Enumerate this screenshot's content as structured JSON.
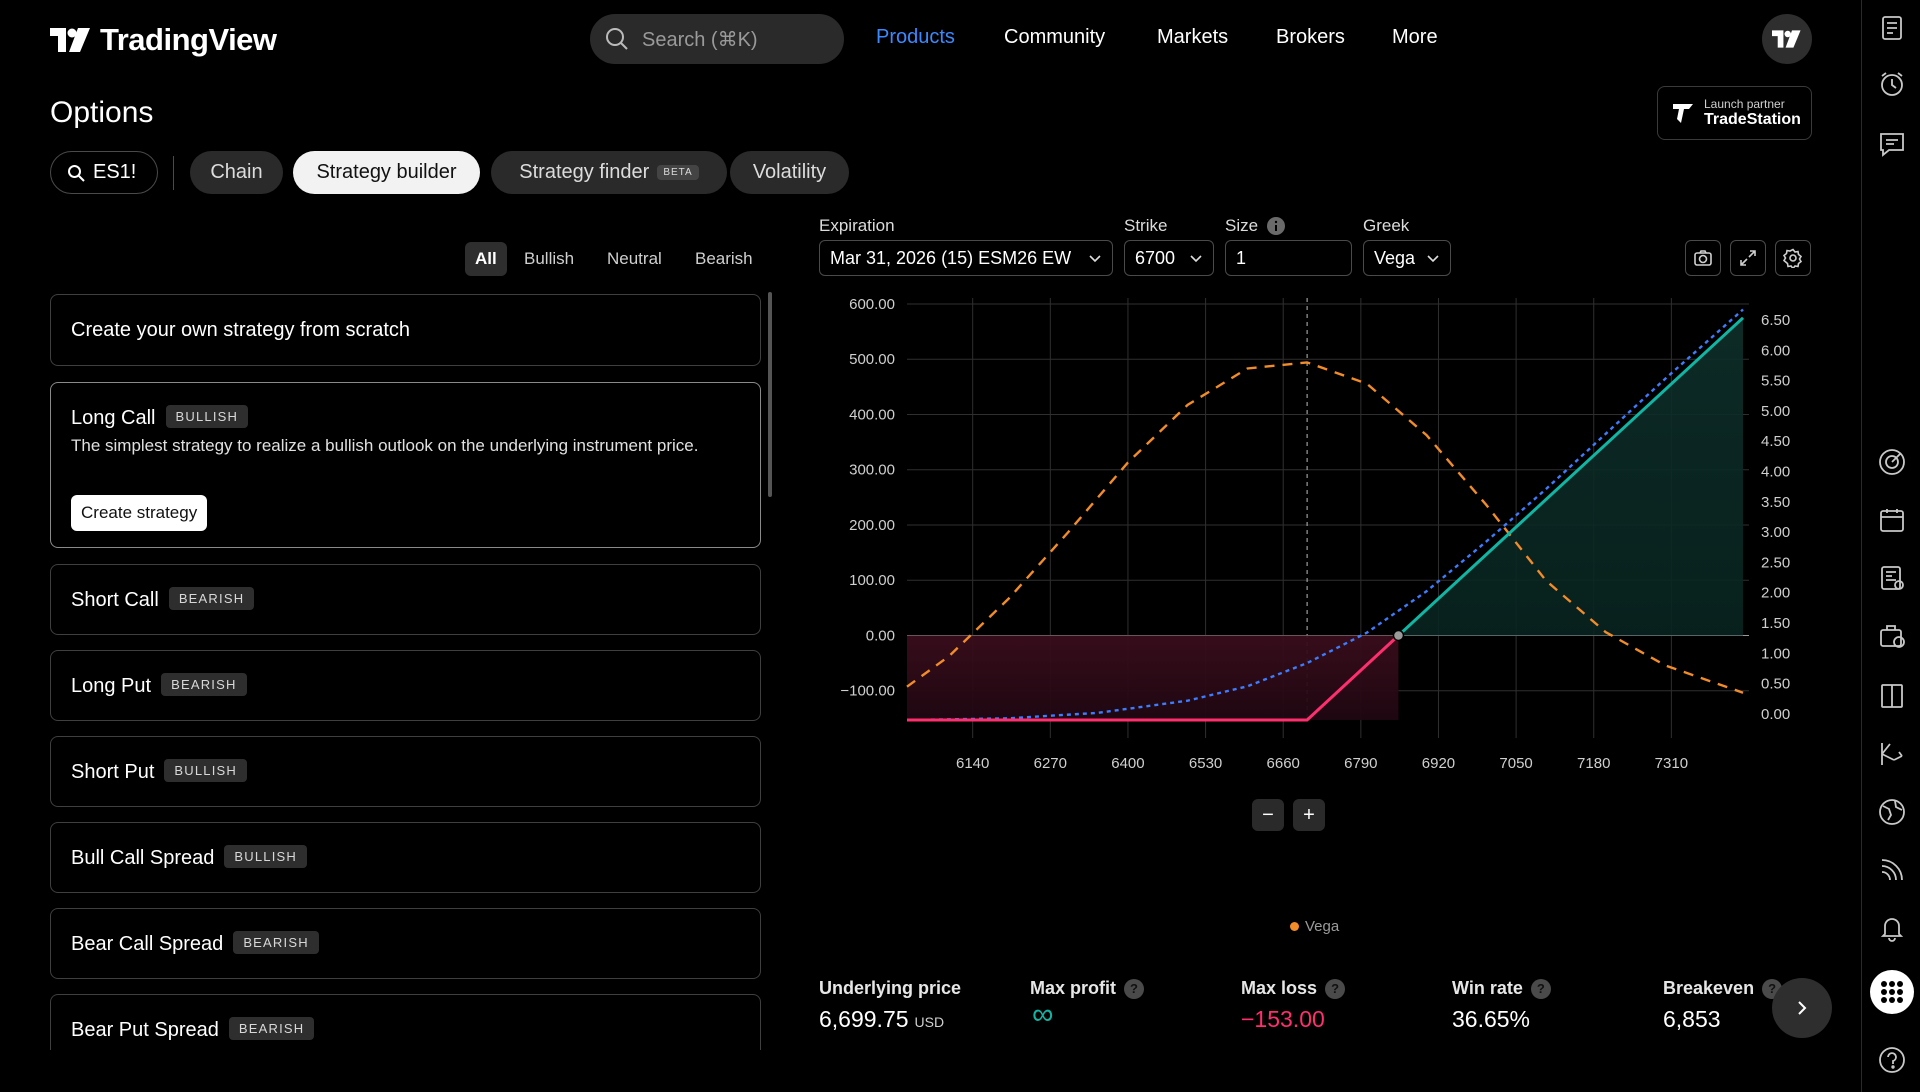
{
  "header": {
    "brand": "TradingView",
    "search_placeholder": "Search (⌘K)",
    "nav": [
      "Products",
      "Community",
      "Markets",
      "Brokers",
      "More"
    ],
    "active_nav": "Products"
  },
  "page": {
    "title": "Options",
    "symbol": "ES1!",
    "tabs": [
      "Chain",
      "Strategy builder",
      "Strategy finder",
      "Volatility"
    ],
    "selected_tab": "Strategy builder",
    "beta_label": "BETA",
    "partner_line1": "Launch partner",
    "partner_line2": "TradeStation"
  },
  "filters": [
    "All",
    "Bullish",
    "Neutral",
    "Bearish"
  ],
  "selected_filter": "All",
  "strategies": {
    "scratch": "Create your own strategy from scratch",
    "long_call": {
      "name": "Long Call",
      "badge": "BULLISH",
      "desc": "The simplest strategy to realize a bullish outlook on the underlying instrument price.",
      "button": "Create strategy"
    },
    "items": [
      {
        "name": "Short Call",
        "badge": "BEARISH"
      },
      {
        "name": "Long Put",
        "badge": "BEARISH"
      },
      {
        "name": "Short Put",
        "badge": "BULLISH"
      },
      {
        "name": "Bull Call Spread",
        "badge": "BULLISH"
      },
      {
        "name": "Bear Call Spread",
        "badge": "BEARISH"
      },
      {
        "name": "Bear Put Spread",
        "badge": "BEARISH"
      }
    ]
  },
  "controls": {
    "expiration_label": "Expiration",
    "expiration_value": "Mar 31, 2026 (15) ESM26 EW",
    "strike_label": "Strike",
    "strike_value": "6700",
    "size_label": "Size",
    "size_value": "1",
    "greek_label": "Greek",
    "greek_value": "Vega"
  },
  "chart_data": {
    "type": "line",
    "x_ticks": [
      "6140",
      "6270",
      "6400",
      "6530",
      "6660",
      "6790",
      "6920",
      "7050",
      "7180",
      "7310"
    ],
    "y_left_ticks": [
      "600.00",
      "500.00",
      "400.00",
      "300.00",
      "200.00",
      "100.00",
      "0.00",
      "−100.00"
    ],
    "y_right_ticks": [
      "6.50",
      "6.00",
      "5.50",
      "5.00",
      "4.50",
      "4.00",
      "3.50",
      "3.00",
      "2.50",
      "2.00",
      "1.50",
      "1.00",
      "0.50",
      "0.00"
    ],
    "xlim": [
      6030,
      7440
    ],
    "ylim_left": [
      -153,
      600
    ],
    "ylim_right": [
      -0.1,
      6.5
    ],
    "strike": 6700,
    "breakeven": 6853,
    "max_loss": -153,
    "payoff": {
      "x": [
        6030,
        6700,
        6853,
        7430
      ],
      "y": [
        -153,
        -153,
        0,
        575
      ]
    },
    "theoretical_pnl": {
      "x": [
        6030,
        6200,
        6350,
        6500,
        6600,
        6700,
        6800,
        6900,
        7000,
        7100,
        7200,
        7300,
        7430
      ],
      "y": [
        -153,
        -150,
        -140,
        -118,
        -92,
        -50,
        5,
        80,
        170,
        265,
        365,
        465,
        590
      ]
    },
    "vega": {
      "x": [
        6030,
        6100,
        6200,
        6300,
        6400,
        6500,
        6600,
        6700,
        6800,
        6900,
        7000,
        7100,
        7200,
        7300,
        7430
      ],
      "y": [
        0.45,
        0.95,
        1.9,
        3.0,
        4.15,
        5.1,
        5.7,
        5.8,
        5.45,
        4.6,
        3.45,
        2.2,
        1.35,
        0.8,
        0.35
      ]
    },
    "legend": [
      "Vega"
    ],
    "colors": {
      "vega": "#f28c28",
      "pnl": "#3d7bff",
      "profit": "#10b5a3",
      "loss": "#ff2e6e"
    }
  },
  "zoom": {
    "minus": "−",
    "plus": "+"
  },
  "stats": [
    {
      "label": "Underlying price",
      "value": "6,699.75",
      "unit": "USD"
    },
    {
      "label": "Max profit",
      "value": "∞"
    },
    {
      "label": "Max loss",
      "value": "−153.00"
    },
    {
      "label": "Win rate",
      "value": "36.65%"
    },
    {
      "label": "Breakeven",
      "value": "6,853"
    }
  ],
  "icons": [
    "watchlist-icon",
    "alarm-clock-icon",
    "chat-icon",
    "target-icon",
    "calendar-icon",
    "news-icon",
    "briefcase-icon",
    "book-icon",
    "trade-icon",
    "globe-icon",
    "stream-icon",
    "bell-icon",
    "apps-icon",
    "help-icon"
  ]
}
